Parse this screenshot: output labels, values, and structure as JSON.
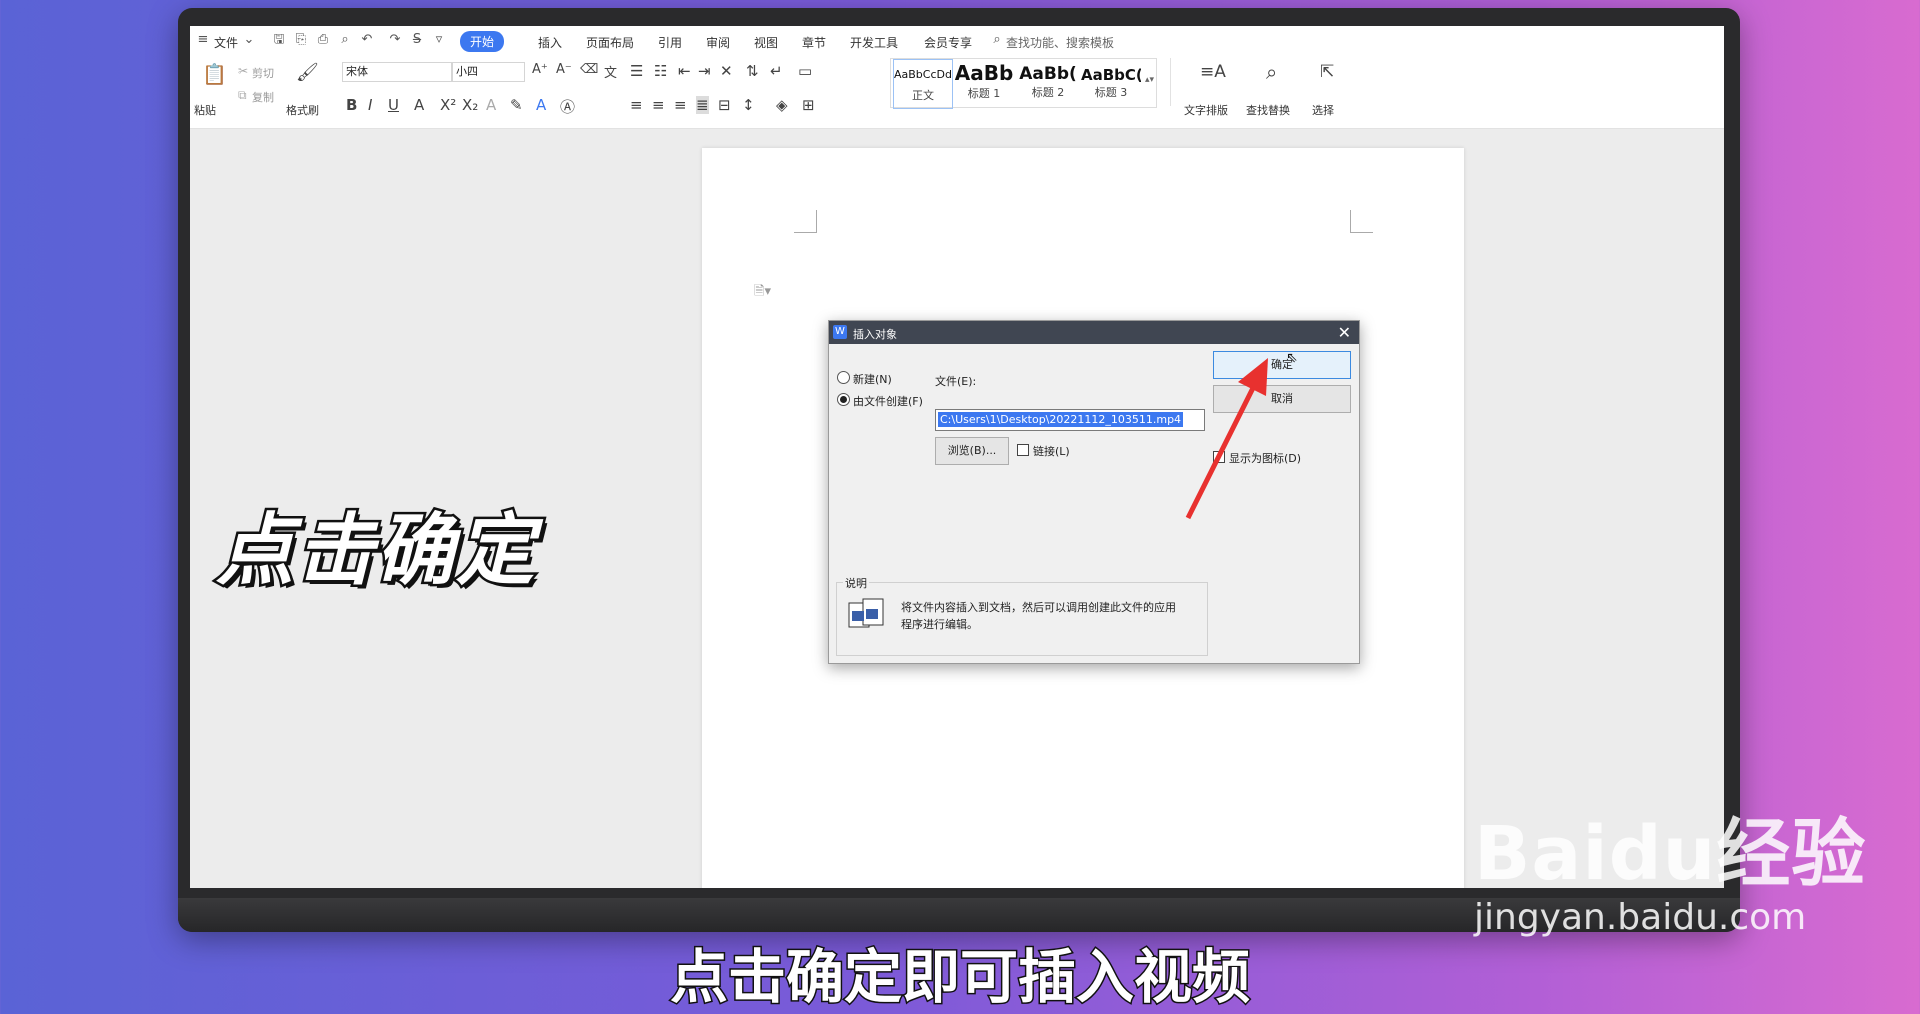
{
  "menu": {
    "file": "文件",
    "tabs": [
      "开始",
      "插入",
      "页面布局",
      "引用",
      "审阅",
      "视图",
      "章节",
      "开发工具",
      "会员专享"
    ],
    "search_placeholder": "查找功能、搜索模板"
  },
  "toolbar": {
    "paste": "粘贴",
    "cut": "剪切",
    "copy": "复制",
    "format_painter": "格式刷",
    "font_name": "宋体",
    "font_size": "小四",
    "styles": [
      {
        "preview": "AaBbCcDd",
        "label": "正文"
      },
      {
        "preview": "AaBb",
        "label": "标题 1"
      },
      {
        "preview": "AaBb(",
        "label": "标题 2"
      },
      {
        "preview": "AaBbC(",
        "label": "标题 3"
      }
    ],
    "text_layout": "文字排版",
    "find_replace": "查找替换",
    "select": "选择"
  },
  "dialog": {
    "title": "插入对象",
    "close": "✕",
    "new_option": "新建(N)",
    "from_file_option": "由文件创建(F)",
    "file_label": "文件(E):",
    "file_value": "C:\\Users\\1\\Desktop\\20221112_103511.mp4",
    "browse": "浏览(B)...",
    "link": "链接(L)",
    "show_as_icon": "显示为图标(D)",
    "ok": "确定",
    "cancel": "取消",
    "description_title": "说明",
    "description_text_line1": "将文件内容插入到文档，然后可以调用创建此文件的应用",
    "description_text_line2": "程序进行编辑。"
  },
  "overlay": {
    "title": "点击确定",
    "subtitle": "点击确定即可插入视频"
  },
  "watermark": {
    "brand": "Baidu经验",
    "url": "jingyan.baidu.com"
  },
  "colors": {
    "accent": "#3c78f0",
    "arrow": "#e8312f"
  }
}
